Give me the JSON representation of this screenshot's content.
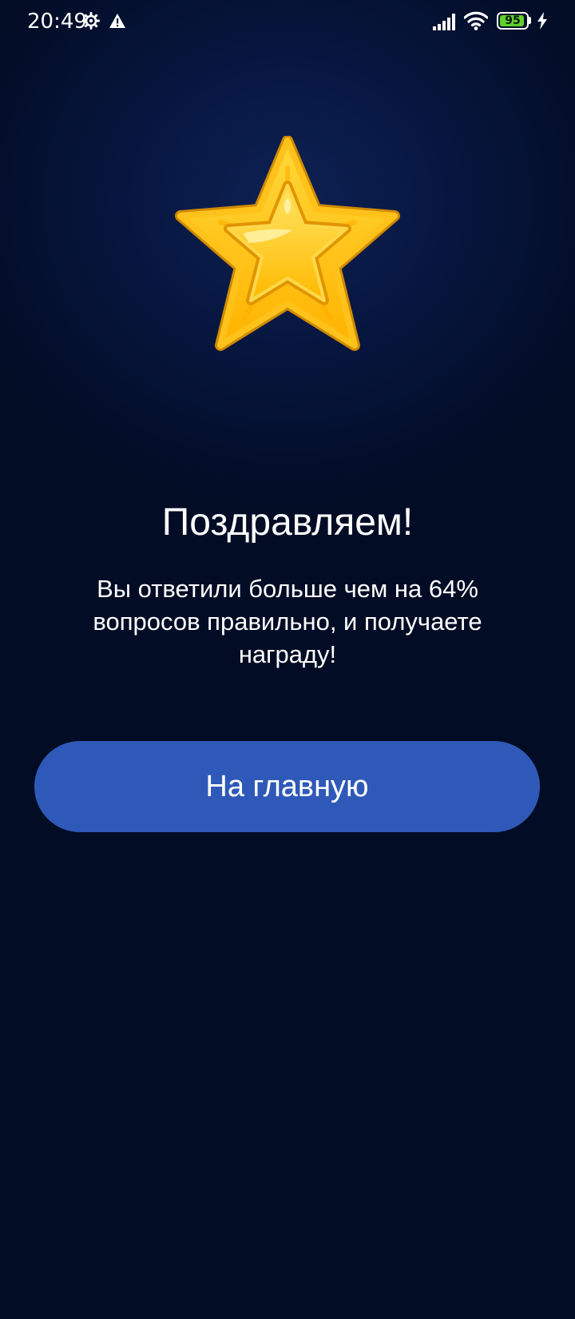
{
  "status_bar": {
    "time": "20:49",
    "battery_level": "95",
    "battery_fraction": 0.95,
    "icons": [
      "gear-icon",
      "warning-icon",
      "signal-icon",
      "wifi-icon",
      "battery-icon",
      "charging-bolt-icon"
    ]
  },
  "main": {
    "title": "Поздравляем!",
    "message": "Вы ответили больше чем на 64% вопросов правильно, и получаете награду!",
    "home_button_label": "На главную",
    "reward_icon": "star-icon"
  },
  "colors": {
    "background": "#020c25",
    "accent_button": "#2f59b8",
    "star_gold": "#ffc21a",
    "battery_green": "#5fd12b"
  }
}
